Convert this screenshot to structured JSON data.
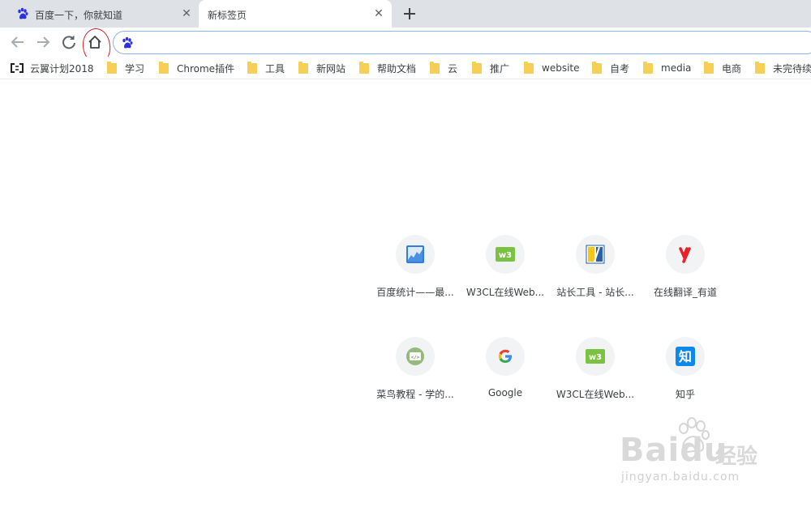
{
  "tabs": [
    {
      "title": "百度一下，你就知道",
      "icon": "baidu-paw-icon",
      "active": false
    },
    {
      "title": "新标签页",
      "icon": "",
      "active": true
    }
  ],
  "omnibox": {
    "value": "",
    "placeholder": ""
  },
  "bookmarks": [
    {
      "label": "云翼计划2018",
      "icon": "app-icon"
    },
    {
      "label": "学习",
      "icon": "folder-icon"
    },
    {
      "label": "Chrome插件",
      "icon": "folder-icon"
    },
    {
      "label": "工具",
      "icon": "folder-icon"
    },
    {
      "label": "新网站",
      "icon": "folder-icon"
    },
    {
      "label": "帮助文档",
      "icon": "folder-icon"
    },
    {
      "label": "云",
      "icon": "folder-icon"
    },
    {
      "label": "推广",
      "icon": "folder-icon"
    },
    {
      "label": "website",
      "icon": "folder-icon"
    },
    {
      "label": "自考",
      "icon": "folder-icon"
    },
    {
      "label": "media",
      "icon": "folder-icon"
    },
    {
      "label": "电商",
      "icon": "folder-icon"
    },
    {
      "label": "未完待续",
      "icon": "folder-icon"
    }
  ],
  "shortcuts": [
    {
      "label": "百度统计——最...",
      "icon": "baidu-tongji-icon"
    },
    {
      "label": "W3CL在线Web...",
      "icon": "w3cl-icon"
    },
    {
      "label": "站长工具 - 站长...",
      "icon": "chinaz-icon"
    },
    {
      "label": "在线翻译_有道",
      "icon": "youdao-icon"
    },
    {
      "label": "菜鸟教程 - 学的...",
      "icon": "runoob-icon"
    },
    {
      "label": "Google",
      "icon": "google-icon"
    },
    {
      "label": "W3CL在线Web...",
      "icon": "w3cl-icon"
    },
    {
      "label": "知乎",
      "icon": "zhihu-icon"
    }
  ],
  "watermark": {
    "brand": "Baidu",
    "brand_cn": "经验",
    "url": "jingyan.baidu.com"
  },
  "colors": {
    "annotation": "#d2232a",
    "folder": "#f6cf57",
    "omnibox_border": "#8ab4f8"
  }
}
